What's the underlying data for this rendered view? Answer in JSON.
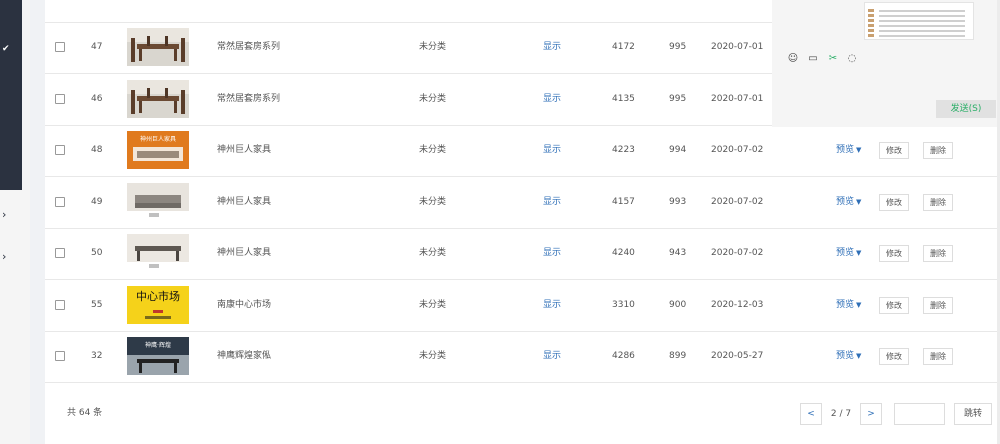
{
  "rows": [
    {
      "id": "47",
      "name": "常然居套房系列",
      "category": "未分类",
      "status": "显示",
      "views": "4172",
      "sort": "995",
      "date": "2020-07-01",
      "thumb": "dining",
      "has_actions": false
    },
    {
      "id": "46",
      "name": "常然居套房系列",
      "category": "未分类",
      "status": "显示",
      "views": "4135",
      "sort": "995",
      "date": "2020-07-01",
      "thumb": "dining",
      "has_actions": false
    },
    {
      "id": "48",
      "name": "神州巨人家具",
      "category": "未分类",
      "status": "显示",
      "views": "4223",
      "sort": "994",
      "date": "2020-07-02",
      "thumb": "orange-banner",
      "thumb_text": "神州巨人家具",
      "has_actions": true
    },
    {
      "id": "49",
      "name": "神州巨人家具",
      "category": "未分类",
      "status": "显示",
      "views": "4157",
      "sort": "993",
      "date": "2020-07-02",
      "thumb": "sofa",
      "has_actions": true
    },
    {
      "id": "50",
      "name": "神州巨人家具",
      "category": "未分类",
      "status": "显示",
      "views": "4240",
      "sort": "943",
      "date": "2020-07-02",
      "thumb": "table",
      "has_actions": true
    },
    {
      "id": "55",
      "name": "南康中心市场",
      "category": "未分类",
      "status": "显示",
      "views": "3310",
      "sort": "900",
      "date": "2020-12-03",
      "thumb": "yellow-sign",
      "thumb_text": "中心市场",
      "has_actions": true
    },
    {
      "id": "32",
      "name": "神鹰辉煌家俬",
      "category": "未分类",
      "status": "显示",
      "views": "4286",
      "sort": "899",
      "date": "2020-05-27",
      "thumb": "dark-banner",
      "thumb_text": "神鹰·辉煌",
      "has_actions": true
    }
  ],
  "actions": {
    "preview": "预览",
    "edit": "修改",
    "delete": "删除"
  },
  "footer": {
    "total": "共 64 条",
    "prev": "<",
    "page": "2 / 7",
    "next": ">",
    "jump": "跳转"
  },
  "chat": {
    "send": "发送(S)"
  },
  "icons": [
    "smiley-icon",
    "folder-icon",
    "scissors-icon",
    "chat-bubble-icon"
  ],
  "colors": {
    "link": "#2f6fb7",
    "send_text": "#2aae67",
    "sidebar": "#2b3240"
  }
}
